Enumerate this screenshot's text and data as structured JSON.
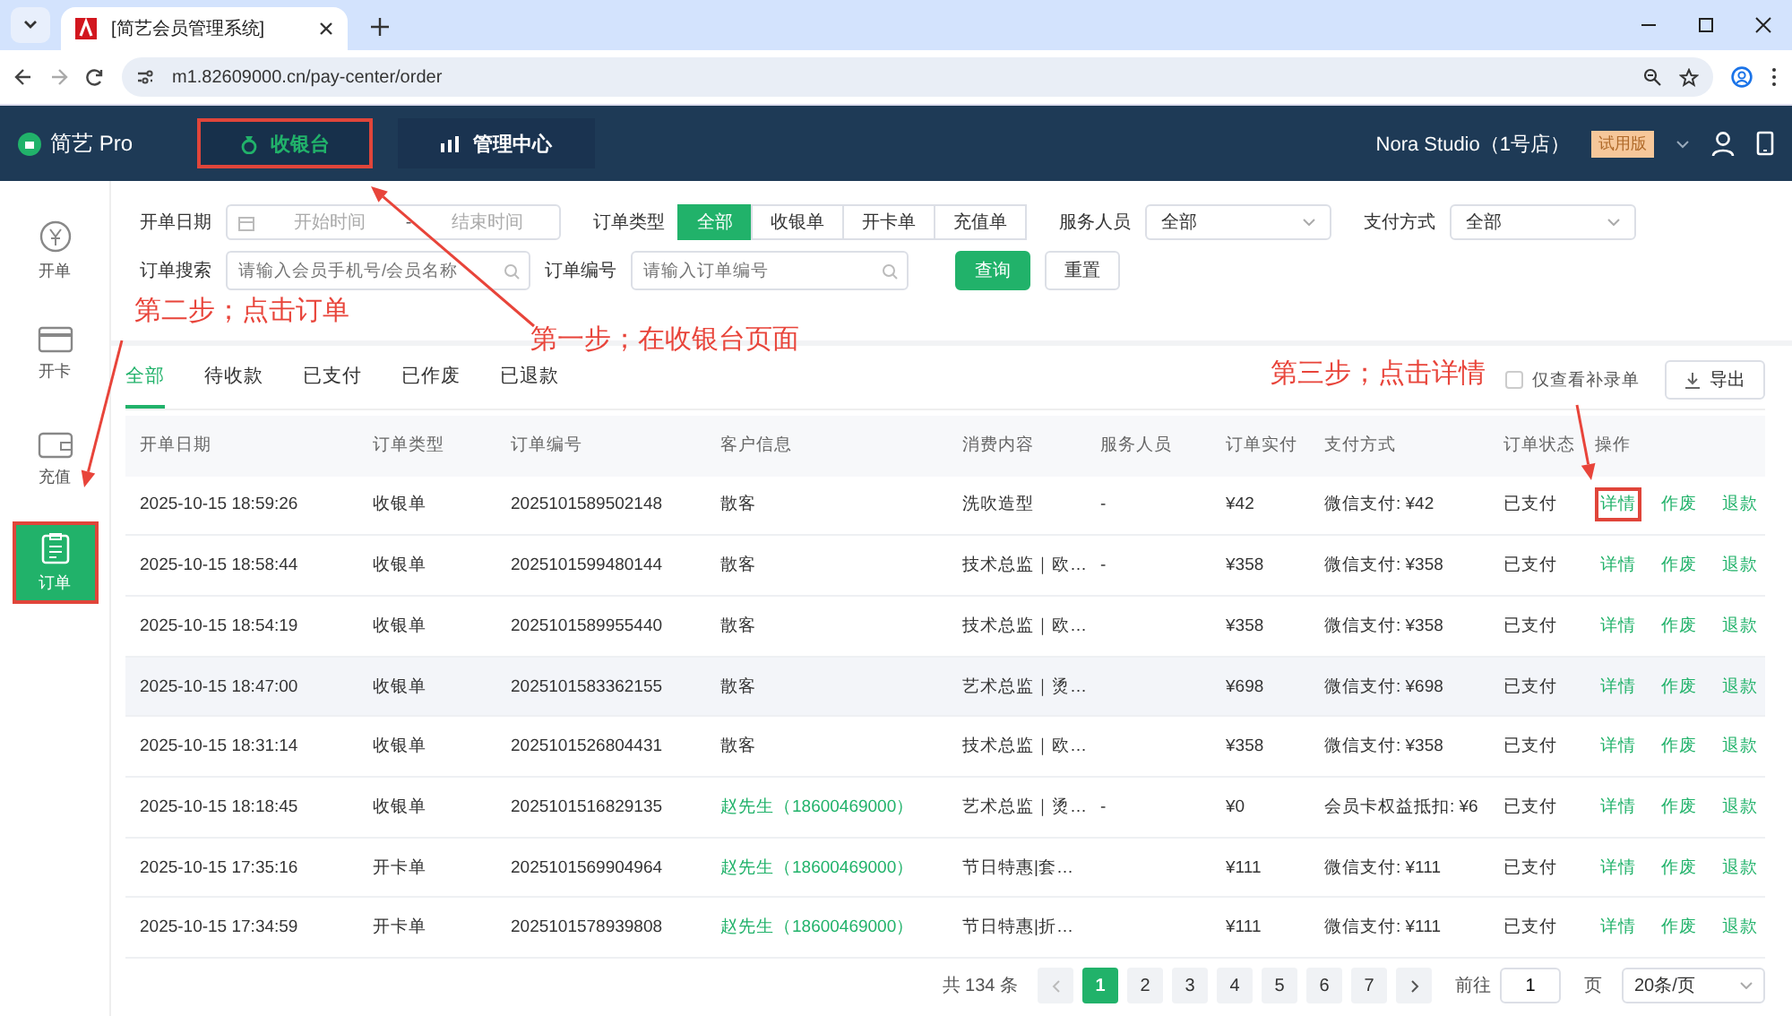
{
  "browser": {
    "tab_title": "[简艺会员管理系统]",
    "url": "m1.82609000.cn/pay-center/order"
  },
  "app": {
    "logo": "简艺 Pro",
    "nav": [
      {
        "label": "收银台",
        "kind": "cashier",
        "selected": true,
        "highlighted": true
      },
      {
        "label": "管理中心",
        "kind": "manage",
        "selected": false,
        "highlighted": false
      }
    ],
    "store": "Nora Studio（1号店）",
    "badge": "试用版"
  },
  "sidebar": {
    "items": [
      {
        "label": "开单",
        "kind": "order",
        "selected": false,
        "highlighted": false
      },
      {
        "label": "开卡",
        "kind": "card",
        "selected": false,
        "highlighted": false
      },
      {
        "label": "充值",
        "kind": "wallet",
        "selected": false,
        "highlighted": false
      },
      {
        "label": "订单",
        "kind": "list",
        "selected": true,
        "highlighted": true
      }
    ]
  },
  "filters": {
    "date": {
      "label": "开单日期",
      "start_placeholder": "开始时间",
      "separator": "-",
      "end_placeholder": "结束时间"
    },
    "order_type": {
      "label": "订单类型",
      "options": [
        {
          "label": "全部",
          "selected": true
        },
        {
          "label": "收银单",
          "selected": false
        },
        {
          "label": "开卡单",
          "selected": false
        },
        {
          "label": "充值单",
          "selected": false
        }
      ]
    },
    "staff": {
      "label": "服务人员",
      "value": "全部"
    },
    "payment": {
      "label": "支付方式",
      "value": "全部"
    },
    "search": {
      "label": "订单搜索",
      "placeholder": "请输入会员手机号/会员名称"
    },
    "order_no": {
      "label": "订单编号",
      "placeholder": "请输入订单编号"
    },
    "buttons": [
      {
        "label": "查询",
        "kind": "primary"
      },
      {
        "label": "重置",
        "kind": "plain"
      }
    ]
  },
  "status_tabs": [
    {
      "label": "全部",
      "selected": true
    },
    {
      "label": "待收款",
      "selected": false
    },
    {
      "label": "已支付",
      "selected": false
    },
    {
      "label": "已作废",
      "selected": false
    },
    {
      "label": "已退款",
      "selected": false
    }
  ],
  "supplement_filter": {
    "label": "仅查看补录单",
    "checked": false
  },
  "export_button": "导出",
  "table": {
    "columns": [
      "开单日期",
      "订单类型",
      "订单编号",
      "客户信息",
      "消费内容",
      "服务人员",
      "订单实付",
      "支付方式",
      "订单状态",
      "操作"
    ],
    "rows": [
      {
        "date": "2025-10-15 18:59:26",
        "type": "收银单",
        "number": "2025101589502148",
        "customer": {
          "text": "散客",
          "kind": "guest"
        },
        "content": "洗吹造型",
        "staff": "-",
        "paid": "¥42",
        "payment": "微信支付: ¥42",
        "status": "已支付",
        "hovered": false,
        "actions": [
          {
            "label": "详情",
            "highlighted": true
          },
          {
            "label": "作废",
            "highlighted": false
          },
          {
            "label": "退款",
            "highlighted": false
          }
        ]
      },
      {
        "date": "2025-10-15 18:58:44",
        "type": "收银单",
        "number": "2025101599480144",
        "customer": {
          "text": "散客",
          "kind": "guest"
        },
        "content": "技术总监｜欧…",
        "staff": "-",
        "paid": "¥358",
        "payment": "微信支付: ¥358",
        "status": "已支付",
        "hovered": false,
        "actions": [
          {
            "label": "详情",
            "highlighted": false
          },
          {
            "label": "作废",
            "highlighted": false
          },
          {
            "label": "退款",
            "highlighted": false
          }
        ]
      },
      {
        "date": "2025-10-15 18:54:19",
        "type": "收银单",
        "number": "2025101589955440",
        "customer": {
          "text": "散客",
          "kind": "guest"
        },
        "content": "技术总监｜欧…",
        "paid": "¥358",
        "payment": "微信支付: ¥358",
        "status": "已支付",
        "hovered": false,
        "actions": [
          {
            "label": "详情",
            "highlighted": false
          },
          {
            "label": "作废",
            "highlighted": false
          },
          {
            "label": "退款",
            "highlighted": false
          }
        ]
      },
      {
        "date": "2025-10-15 18:47:00",
        "type": "收银单",
        "number": "2025101583362155",
        "customer": {
          "text": "散客",
          "kind": "guest"
        },
        "content": "艺术总监｜烫…",
        "paid": "¥698",
        "payment": "微信支付: ¥698",
        "status": "已支付",
        "hovered": true,
        "actions": [
          {
            "label": "详情",
            "highlighted": false
          },
          {
            "label": "作废",
            "highlighted": false
          },
          {
            "label": "退款",
            "highlighted": false
          }
        ]
      },
      {
        "date": "2025-10-15 18:31:14",
        "type": "收银单",
        "number": "2025101526804431",
        "customer": {
          "text": "散客",
          "kind": "guest"
        },
        "content": "技术总监｜欧…",
        "paid": "¥358",
        "payment": "微信支付: ¥358",
        "status": "已支付",
        "hovered": false,
        "actions": [
          {
            "label": "详情",
            "highlighted": false
          },
          {
            "label": "作废",
            "highlighted": false
          },
          {
            "label": "退款",
            "highlighted": false
          }
        ]
      },
      {
        "date": "2025-10-15 18:18:45",
        "type": "收银单",
        "number": "2025101516829135",
        "customer": {
          "text": "赵先生（18600469000）",
          "kind": "member"
        },
        "content": "艺术总监｜烫…",
        "staff": "-",
        "paid": "¥0",
        "payment": "会员卡权益抵扣: ¥6",
        "status": "已支付",
        "hovered": false,
        "actions": [
          {
            "label": "详情",
            "highlighted": false
          },
          {
            "label": "作废",
            "highlighted": false
          },
          {
            "label": "退款",
            "highlighted": false
          }
        ]
      },
      {
        "date": "2025-10-15 17:35:16",
        "type": "开卡单",
        "number": "2025101569904964",
        "customer": {
          "text": "赵先生（18600469000）",
          "kind": "member"
        },
        "content": "节日特惠|套…",
        "paid": "¥111",
        "payment": "微信支付: ¥111",
        "status": "已支付",
        "hovered": false,
        "actions": [
          {
            "label": "详情",
            "highlighted": false
          },
          {
            "label": "作废",
            "highlighted": false
          },
          {
            "label": "退款",
            "highlighted": false
          }
        ]
      },
      {
        "date": "2025-10-15 17:34:59",
        "type": "开卡单",
        "number": "2025101578939808",
        "customer": {
          "text": "赵先生（18600469000）",
          "kind": "member"
        },
        "content": "节日特惠|折…",
        "paid": "¥111",
        "payment": "微信支付: ¥111",
        "status": "已支付",
        "hovered": false,
        "actions": [
          {
            "label": "详情",
            "highlighted": false
          },
          {
            "label": "作废",
            "highlighted": false
          },
          {
            "label": "退款",
            "highlighted": false
          }
        ]
      }
    ]
  },
  "pagination": {
    "total": "共 134 条",
    "pages": [
      {
        "label": "1",
        "selected": true
      },
      {
        "label": "2",
        "selected": false
      },
      {
        "label": "3",
        "selected": false
      },
      {
        "label": "4",
        "selected": false
      },
      {
        "label": "5",
        "selected": false
      },
      {
        "label": "6",
        "selected": false
      },
      {
        "label": "7",
        "selected": false
      }
    ],
    "goto_label": "前往",
    "goto_value": "1",
    "goto_suffix": "页",
    "page_size": "20条/页"
  },
  "annotations": [
    {
      "text": "第二步；点击订单"
    },
    {
      "text": "第一步；在收银台页面"
    },
    {
      "text": "第三步；点击详情"
    }
  ]
}
